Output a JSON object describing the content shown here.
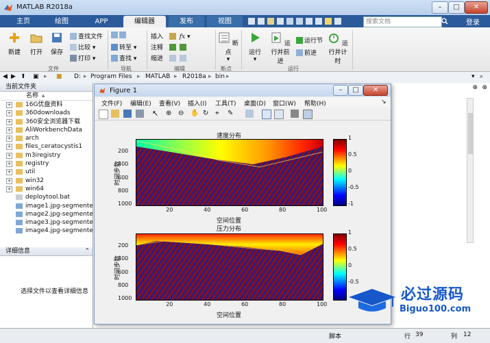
{
  "window": {
    "title": "MATLAB R2018a"
  },
  "tabs": [
    "主页",
    "绘图",
    "APP",
    "编辑器",
    "发布",
    "视图"
  ],
  "search": {
    "placeholder": "搜索文档"
  },
  "login": "登录",
  "ribbon": {
    "file_group": {
      "label": "文件",
      "new": "新建",
      "open": "打开",
      "save": "保存",
      "find_files": "查找文件",
      "compare": "比较",
      "print": "打印"
    },
    "nav_group": {
      "label": "导航",
      "goto": "转至",
      "find": "查找"
    },
    "edit_group": {
      "label": "编辑",
      "insert": "插入",
      "comment": "注释",
      "indent": "缩进"
    },
    "breakpoint_group": {
      "label": "断点",
      "breakpoints": "断点"
    },
    "run_group": {
      "label": "运行",
      "run": "运行",
      "run_advance": "运行并前进",
      "run_section": "运行节",
      "advance": "前进",
      "run_time": "运行并计时"
    }
  },
  "address": {
    "crumbs": [
      "D:",
      "Program Files",
      "MATLAB",
      "R2018a",
      "bin"
    ]
  },
  "current_folder": {
    "title": "当前文件夹",
    "column": "名称",
    "items": [
      {
        "name": "16G优盘资料",
        "type": "folder"
      },
      {
        "name": "360downloads",
        "type": "folder"
      },
      {
        "name": "360安全浏览器下载",
        "type": "folder"
      },
      {
        "name": "AliWorkbenchData",
        "type": "folder"
      },
      {
        "name": "arch",
        "type": "folder"
      },
      {
        "name": "files_ceratocystis1",
        "type": "folder"
      },
      {
        "name": "m3iregistry",
        "type": "folder"
      },
      {
        "name": "registry",
        "type": "folder"
      },
      {
        "name": "util",
        "type": "folder"
      },
      {
        "name": "win32",
        "type": "folder"
      },
      {
        "name": "win64",
        "type": "folder"
      },
      {
        "name": "deploytool.bat",
        "type": "file"
      },
      {
        "name": "image1.jpg-segmente...",
        "type": "image"
      },
      {
        "name": "image2.jpg-segmente...",
        "type": "image"
      },
      {
        "name": "image3.jpg-segmente...",
        "type": "image"
      },
      {
        "name": "image4.jpg-segmente...",
        "type": "image"
      }
    ]
  },
  "details": {
    "title": "详细信息",
    "message": "选择文件以查看详细信息"
  },
  "figure": {
    "title": "Figure 1",
    "menu": [
      "文件(F)",
      "编辑(E)",
      "查看(V)",
      "插入(I)",
      "工具(T)",
      "桌面(D)",
      "窗口(W)",
      "帮助(H)"
    ]
  },
  "chart_data": [
    {
      "type": "heatmap",
      "title": "速度分布",
      "xlabel": "空间位置",
      "ylabel": "时间步数",
      "x_ticks": [
        20,
        40,
        60,
        80,
        100
      ],
      "y_ticks": [
        200,
        400,
        600,
        800,
        1000
      ],
      "xlim": [
        1,
        100
      ],
      "ylim": [
        1,
        1000
      ],
      "colorbar_ticks": [
        1,
        0.5,
        0,
        -0.5,
        -1
      ],
      "clim": [
        -1,
        1
      ]
    },
    {
      "type": "heatmap",
      "title": "压力分布",
      "xlabel": "空间位置",
      "ylabel": "时间步数",
      "x_ticks": [
        20,
        40,
        60,
        80,
        100
      ],
      "y_ticks": [
        200,
        400,
        600,
        800,
        1000
      ],
      "xlim": [
        1,
        100
      ],
      "ylim": [
        1,
        1000
      ],
      "colorbar_ticks": [
        1,
        0.5,
        0,
        -0.5
      ],
      "clim": [
        -1,
        1
      ]
    }
  ],
  "status": {
    "type": "脚本",
    "line_label": "行",
    "line": "39",
    "col_label": "列",
    "col": "12"
  },
  "watermark": {
    "text": "必过源码",
    "url": "Biguo100.com"
  }
}
